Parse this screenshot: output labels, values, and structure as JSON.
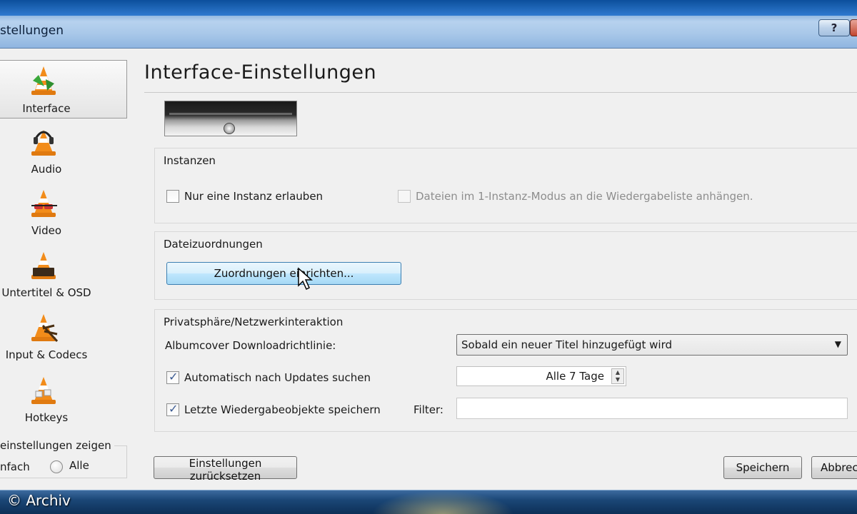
{
  "window": {
    "title": "stellungen",
    "help_label": "?"
  },
  "sidebar": {
    "items": [
      {
        "label": "Interface",
        "icon": "vlc-cone-interface-icon"
      },
      {
        "label": "Audio",
        "icon": "vlc-cone-headphones-icon"
      },
      {
        "label": "Video",
        "icon": "vlc-cone-glasses-icon"
      },
      {
        "label": "Untertitel & OSD",
        "icon": "vlc-cone-subtitle-icon"
      },
      {
        "label": "Input & Codecs",
        "icon": "vlc-cone-codecs-icon"
      },
      {
        "label": "Hotkeys",
        "icon": "vlc-cone-hotkeys-icon"
      }
    ],
    "selected": "Interface",
    "show_settings": {
      "legend": "einstellungen zeigen",
      "option_simple": "nfach",
      "option_all": "Alle"
    }
  },
  "panel": {
    "title": "Interface-Einstellungen",
    "instanzen": {
      "title": "Instanzen",
      "single_instance": "Nur eine Instanz erlauben",
      "single_instance_checked": false,
      "enqueue": "Dateien im 1-Instanz-Modus an die Wiedergabeliste anhängen.",
      "enqueue_checked": false
    },
    "dateizuordnungen": {
      "title": "Dateizuordnungen",
      "button": "Zuordnungen einrichten..."
    },
    "privacy": {
      "title": "Privatsphäre/Netzwerkinteraktion",
      "art_policy_label": "Albumcover Downloadrichtlinie:",
      "art_policy_value": "Sobald ein neuer Titel hinzugefügt wird",
      "updates_label": "Automatisch nach Updates suchen",
      "updates_checked": true,
      "updates_interval": "Alle 7 Tage",
      "recent_label": "Letzte Wiedergabeobjekte speichern",
      "recent_checked": true,
      "filter_label": "Filter:",
      "filter_value": ""
    }
  },
  "footer": {
    "reset": "Einstellungen zurücksetzen",
    "save": "Speichern",
    "cancel": "Abbrec"
  },
  "overlay": {
    "credit": "© Archiv"
  }
}
